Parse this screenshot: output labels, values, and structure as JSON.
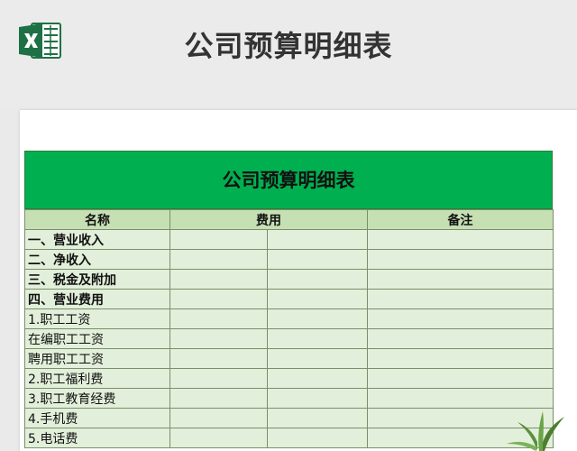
{
  "app": {
    "title": "公司预算明细表",
    "logo_icon": "excel-icon",
    "brand_color": "#1e7145"
  },
  "table": {
    "title": "公司预算明细表",
    "header_color": "#00b050",
    "columns": [
      "名称",
      "费用",
      "备注"
    ],
    "rows": [
      {
        "name": "一、营业收入",
        "bold": true
      },
      {
        "name": "二、净收入",
        "bold": true
      },
      {
        "name": "三、税金及附加",
        "bold": true
      },
      {
        "name": "四、营业费用",
        "bold": true
      },
      {
        "name": "1.职工工资",
        "bold": false
      },
      {
        "name": "在编职工工资",
        "bold": false
      },
      {
        "name": "聘用职工工资",
        "bold": false
      },
      {
        "name": "2.职工福利费",
        "bold": false
      },
      {
        "name": "3.职工教育经费",
        "bold": false
      },
      {
        "name": "4.手机费",
        "bold": false
      },
      {
        "name": "5.电话费",
        "bold": false
      }
    ]
  },
  "decoration": {
    "plant_icon": "plant-icon"
  }
}
